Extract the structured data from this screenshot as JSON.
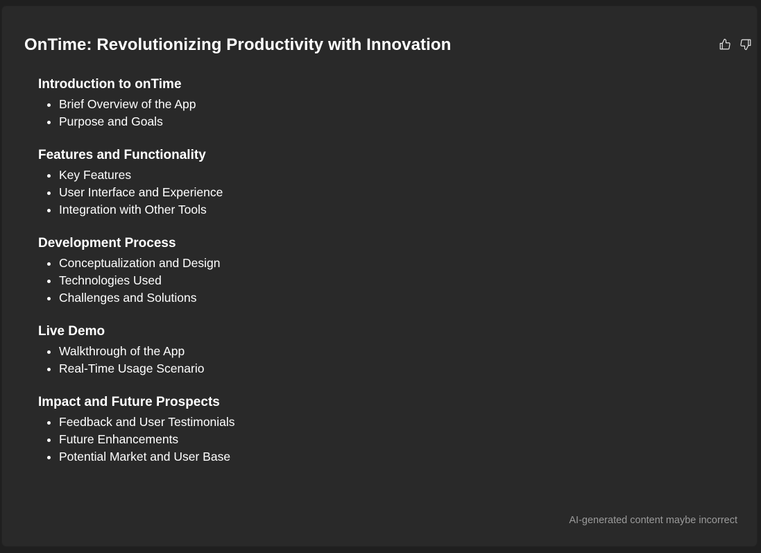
{
  "card": {
    "title": "OnTime: Revolutionizing Productivity with Innovation",
    "feedback": {
      "thumbs_up_icon": "thumbs-up-icon",
      "thumbs_down_icon": "thumbs-down-icon"
    },
    "sections": [
      {
        "heading": "Introduction to onTime",
        "items": [
          "Brief Overview of the App",
          "Purpose and Goals"
        ]
      },
      {
        "heading": "Features and Functionality",
        "items": [
          "Key Features",
          "User Interface and Experience",
          "Integration with Other Tools"
        ]
      },
      {
        "heading": "Development Process",
        "items": [
          "Conceptualization and Design",
          "Technologies Used",
          "Challenges and Solutions"
        ]
      },
      {
        "heading": "Live Demo",
        "items": [
          "Walkthrough of the App",
          "Real-Time Usage Scenario"
        ]
      },
      {
        "heading": "Impact and Future Prospects",
        "items": [
          "Feedback and User Testimonials",
          "Future Enhancements",
          "Potential Market and User Base"
        ]
      }
    ],
    "footer_note": "AI-generated content maybe incorrect"
  },
  "colors": {
    "background": "#1f1f1f",
    "card": "#292929",
    "text": "#ffffff",
    "muted": "#9b9b9b"
  }
}
